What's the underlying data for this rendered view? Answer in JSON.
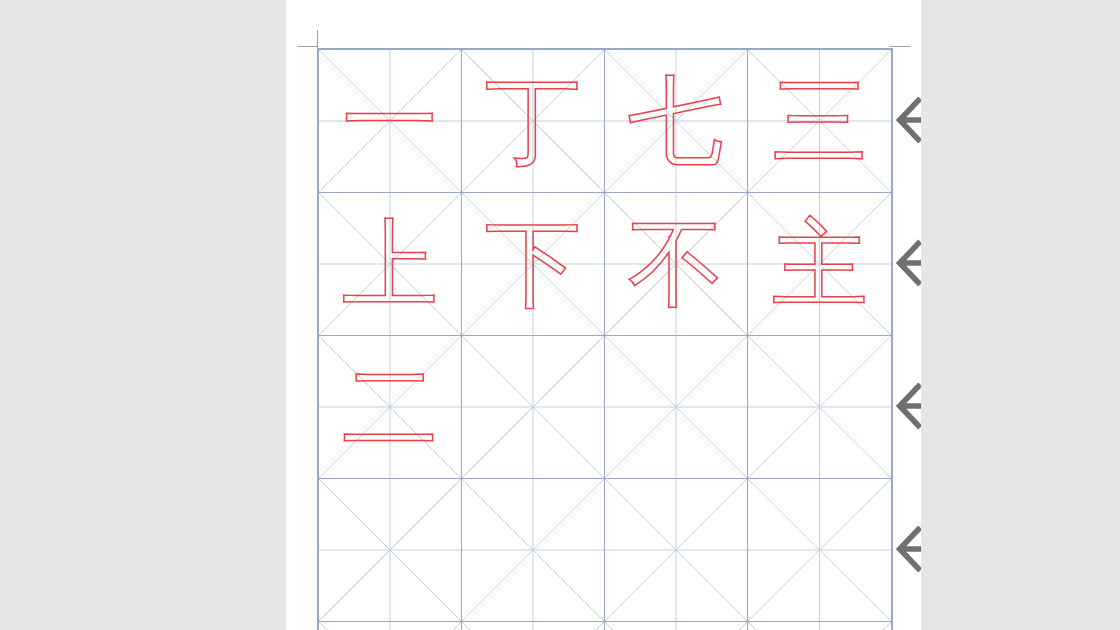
{
  "practice_sheet": {
    "characters": [
      "一",
      "丁",
      "七",
      "三",
      "上",
      "下",
      "不",
      "主",
      "二"
    ]
  }
}
